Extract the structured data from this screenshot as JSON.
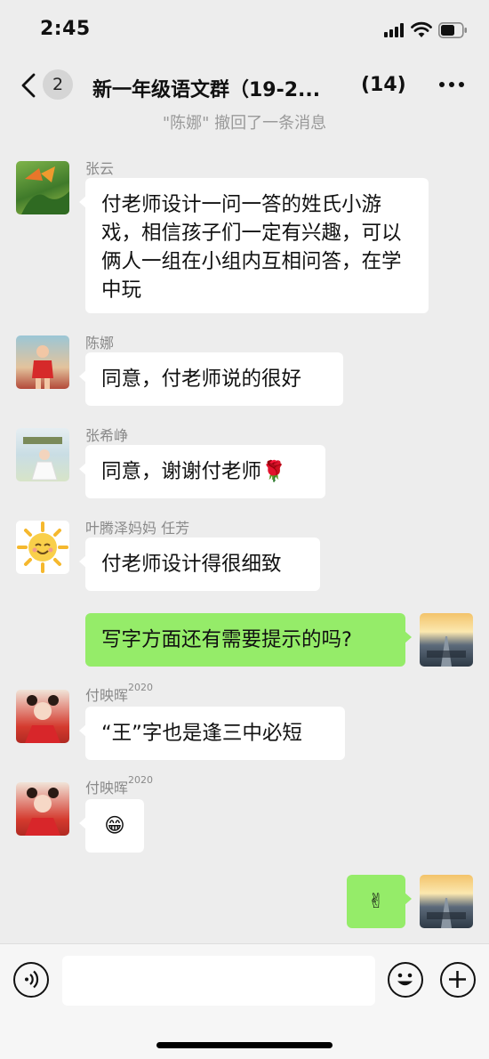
{
  "status_bar": {
    "time": "2:45"
  },
  "nav": {
    "unread_count": "2",
    "title": "新一年级语文群（19-2...",
    "member_count": "(14)"
  },
  "recall_notice": "\"陈娜\" 撤回了一条消息",
  "messages": [
    {
      "sender": "张云",
      "text": "付老师设计一问一答的姓氏小游戏，相信孩子们一定有兴趣，可以俩人一组在小组内互相问答，在学中玩"
    },
    {
      "sender": "陈娜",
      "text": "同意，付老师说的很好"
    },
    {
      "sender": "张希峥",
      "text": "同意，谢谢付老师",
      "emoji": "🌹"
    },
    {
      "sender": "叶腾泽妈妈 任芳",
      "text": "付老师设计得很细致"
    },
    {
      "sender": "",
      "text": "写字方面还有需要提示的吗?"
    },
    {
      "sender": "付映晖",
      "sender_sup": "2020",
      "text": "“王”字也是逢三中必短"
    },
    {
      "sender": "付映晖",
      "sender_sup": "2020",
      "emoji": "😁"
    },
    {
      "sender": "",
      "emoji": "✌"
    }
  ],
  "colors": {
    "background": "#ededed",
    "my_bubble": "#95ec69",
    "their_bubble": "#ffffff",
    "meta_text": "#8a8a8a"
  },
  "icons": [
    "back-chevron-icon",
    "more-dots-icon",
    "voice-icon",
    "emoji-icon",
    "plus-icon"
  ]
}
